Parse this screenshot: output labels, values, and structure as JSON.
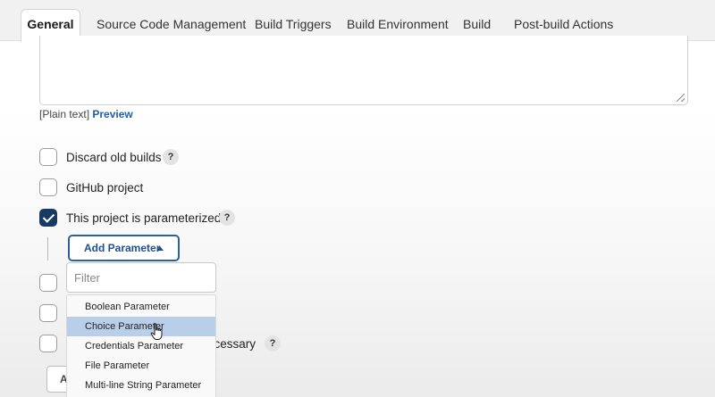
{
  "tabs": [
    {
      "label": "General",
      "active": true
    },
    {
      "label": "Source Code Management"
    },
    {
      "label": "Build Triggers"
    },
    {
      "label": "Build Environment"
    },
    {
      "label": "Build"
    },
    {
      "label": "Post-build Actions"
    }
  ],
  "description": {
    "format_prefix": "[Plain text]",
    "preview_link": "Preview"
  },
  "options": [
    {
      "label": "Discard old builds",
      "checked": false,
      "help": "?"
    },
    {
      "label": "GitHub project",
      "checked": false
    },
    {
      "label": "This project is parameterized",
      "checked": true,
      "help": "?"
    }
  ],
  "add_parameter": {
    "label": "Add Parameter",
    "filter_placeholder": "Filter",
    "menu_items": [
      "Boolean Parameter",
      "Choice Parameter",
      "Credentials Parameter",
      "File Parameter",
      "Multi-line String Parameter"
    ],
    "hovered_item": "Choice Parameter"
  },
  "partially_hidden": {
    "option_suffix": "ecessary",
    "help": "?",
    "button_partial": "A"
  },
  "colors": {
    "accent": "#2d5ea3",
    "checkbox_checked": "#173a63",
    "menu_hover": "#b9cfe9",
    "link": "#1f5fa8"
  }
}
